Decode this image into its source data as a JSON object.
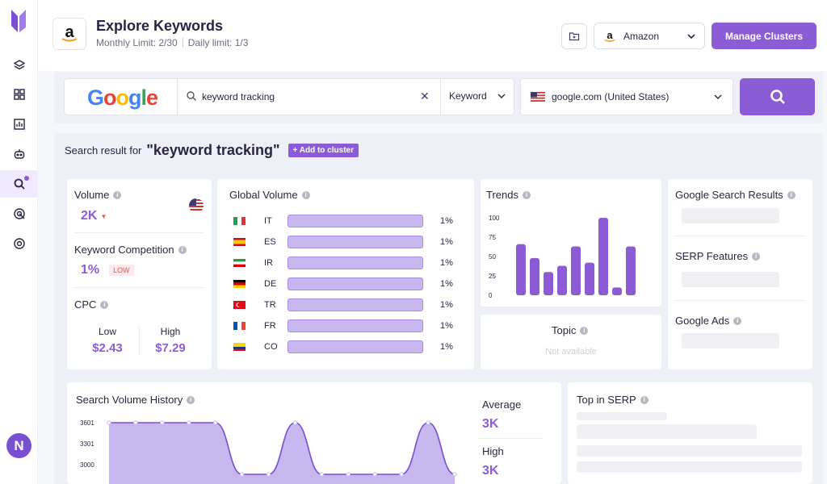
{
  "header": {
    "title": "Explore Keywords",
    "monthly_limit": "Monthly Limit: 2/30",
    "daily_limit": "Daily limit: 1/3",
    "marketplace": "Amazon",
    "manage_clusters": "Manage Clusters",
    "brand_glyph": "a"
  },
  "sidebar": {
    "items": [
      "layers-icon",
      "grid-icon",
      "chart-icon",
      "robot-icon",
      "search-keyword-icon",
      "ads-icon",
      "settings-icon"
    ],
    "avatar_initial": "N"
  },
  "search": {
    "engine_logo": "Google",
    "query": "keyword tracking",
    "type": "Keyword",
    "engine_location": "google.com (United States)"
  },
  "result": {
    "prefix": "Search result for",
    "keyword": "\"keyword tracking\"",
    "add_to_cluster": "+ Add to cluster"
  },
  "volume": {
    "title": "Volume",
    "value": "2K",
    "trend_glyph": "▼"
  },
  "competition": {
    "title": "Keyword Competition",
    "value": "1%",
    "badge": "LOW"
  },
  "cpc": {
    "title": "CPC",
    "low_label": "Low",
    "low_value": "$2.43",
    "high_label": "High",
    "high_value": "$7.29"
  },
  "global_volume": {
    "title": "Global Volume",
    "rows": [
      {
        "code": "IT",
        "pct": "1%",
        "fill": 1.0
      },
      {
        "code": "ES",
        "pct": "1%",
        "fill": 1.0
      },
      {
        "code": "IR",
        "pct": "1%",
        "fill": 1.0
      },
      {
        "code": "DE",
        "pct": "1%",
        "fill": 1.0
      },
      {
        "code": "TR",
        "pct": "1%",
        "fill": 1.0
      },
      {
        "code": "FR",
        "pct": "1%",
        "fill": 1.0
      },
      {
        "code": "CO",
        "pct": "1%",
        "fill": 1.0
      }
    ]
  },
  "trends": {
    "title": "Trends",
    "chart_data": {
      "type": "bar",
      "y_ticks": [
        "100",
        "75",
        "50",
        "25",
        "0"
      ],
      "ylim": [
        0,
        100
      ],
      "values": [
        66,
        48,
        30,
        38,
        63,
        42,
        100,
        10,
        63
      ]
    }
  },
  "topic": {
    "title": "Topic",
    "value": "Not available"
  },
  "google_results": {
    "title": "Google Search Results"
  },
  "serp_features": {
    "title": "SERP Features"
  },
  "google_ads": {
    "title": "Google Ads"
  },
  "volume_history": {
    "title": "Search Volume History",
    "chart_data": {
      "type": "area",
      "y_ticks": [
        "3601",
        "3301",
        "3000"
      ],
      "ylim": [
        3000,
        3601
      ],
      "values": [
        3601,
        3601,
        3601,
        3601,
        3601,
        3000,
        3000,
        3601,
        3000,
        3000,
        3000,
        3000,
        3601,
        3000
      ]
    },
    "average_label": "Average",
    "average_value": "3K",
    "high_label": "High",
    "high_value": "3K"
  },
  "top_serp": {
    "title": "Top in SERP"
  }
}
